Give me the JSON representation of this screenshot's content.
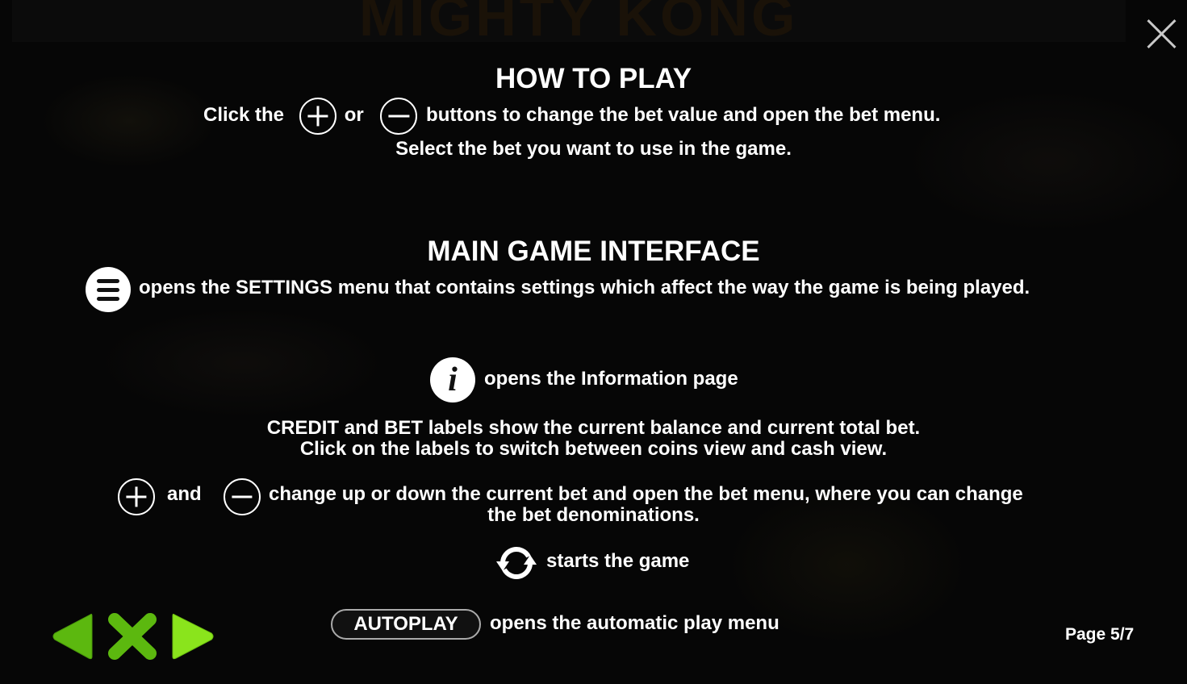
{
  "background": {
    "game_logo_text": "MIGHTY KONG"
  },
  "close_label": "close",
  "how_to_play": {
    "title": "HOW TO PLAY",
    "line1_a": "Click the",
    "line1_b": "or",
    "line1_c": "buttons to change the bet value and open the bet menu.",
    "line2": "Select the bet you want to use in the game."
  },
  "main_interface": {
    "title": "MAIN GAME INTERFACE",
    "settings_text": "opens the SETTINGS menu that contains settings which affect the way the game is being played.",
    "info_glyph": "i",
    "info_text": "opens the Information page",
    "credit_line1": "CREDIT and BET labels show the current balance and current total bet.",
    "credit_line2": "Click on the labels to switch between coins view and cash view.",
    "bet_and": "and",
    "bet_line1": "change up or down the current bet and open the bet menu, where you can change",
    "bet_line2": "the bet denominations.",
    "spin_text": "starts the game",
    "autoplay_label": "AUTOPLAY",
    "autoplay_text": "opens the automatic play menu"
  },
  "navigation": {
    "prev_icon": "left-triangle",
    "close_icon": "x",
    "next_icon": "right-triangle",
    "colors": {
      "prev": "#5cb80f",
      "close": "#5cb80f",
      "next": "#8ae41c"
    }
  },
  "pagination": {
    "label": "Page 5/7",
    "current": 5,
    "total": 7
  }
}
